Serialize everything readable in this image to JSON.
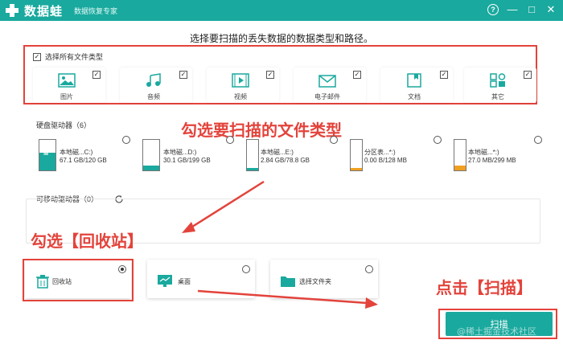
{
  "titlebar": {
    "app_name": "数据蛙",
    "subtitle": "数据恢复专家",
    "help": "?",
    "minimize": "—",
    "maximize": "□",
    "close": "✕"
  },
  "headline": "选择要扫描的丢失数据的数据类型和路径。",
  "file_types": {
    "select_all_label": "选择所有文件类型",
    "select_all_checked": true,
    "items": [
      {
        "label": "图片",
        "icon": "image-icon",
        "checked": true
      },
      {
        "label": "音频",
        "icon": "audio-icon",
        "checked": true
      },
      {
        "label": "视频",
        "icon": "video-icon",
        "checked": true
      },
      {
        "label": "电子邮件",
        "icon": "email-icon",
        "checked": true
      },
      {
        "label": "文档",
        "icon": "document-icon",
        "checked": true
      },
      {
        "label": "其它",
        "icon": "other-icon",
        "checked": true
      }
    ]
  },
  "hard_drives": {
    "title": "硬盘驱动器（6）",
    "items": [
      {
        "name": "本地磁...C:)",
        "size": "67.1 GB/120 GB",
        "fill_color": "#1aa99e",
        "fill_fraction": 0.56
      },
      {
        "name": "本地磁...D:)",
        "size": "30.1 GB/199 GB",
        "fill_color": "#1aa99e",
        "fill_fraction": 0.15
      },
      {
        "name": "本地磁...E:)",
        "size": "2.84 GB/78.8 GB",
        "fill_color": "#1aa99e",
        "fill_fraction": 0.04
      },
      {
        "name": "分区表...*:)",
        "size": "0.00  B/128 MB",
        "fill_color": "#f0a020",
        "fill_fraction": 0.0
      },
      {
        "name": "本地磁...*:)",
        "size": "27.0 MB/299 MB",
        "fill_color": "#f0a020",
        "fill_fraction": 0.09
      }
    ]
  },
  "removable": {
    "title": "可移动驱动器（0）"
  },
  "locations": {
    "items": [
      {
        "label": "回收站",
        "icon": "trash-icon",
        "selected": true
      },
      {
        "label": "桌面",
        "icon": "desktop-icon",
        "selected": false
      },
      {
        "label": "选择文件夹",
        "icon": "folder-icon",
        "selected": false
      }
    ]
  },
  "annotations": {
    "file_types": "勾选要扫描的文件类型",
    "recycle": "勾选【回收站】",
    "scan": "点击【扫描】"
  },
  "scan_button": "扫描",
  "watermark": "@稀土掘金技术社区",
  "colors": {
    "accent": "#1aa99e",
    "annotation_red": "#e3433b",
    "drive_orange": "#f0a020"
  }
}
